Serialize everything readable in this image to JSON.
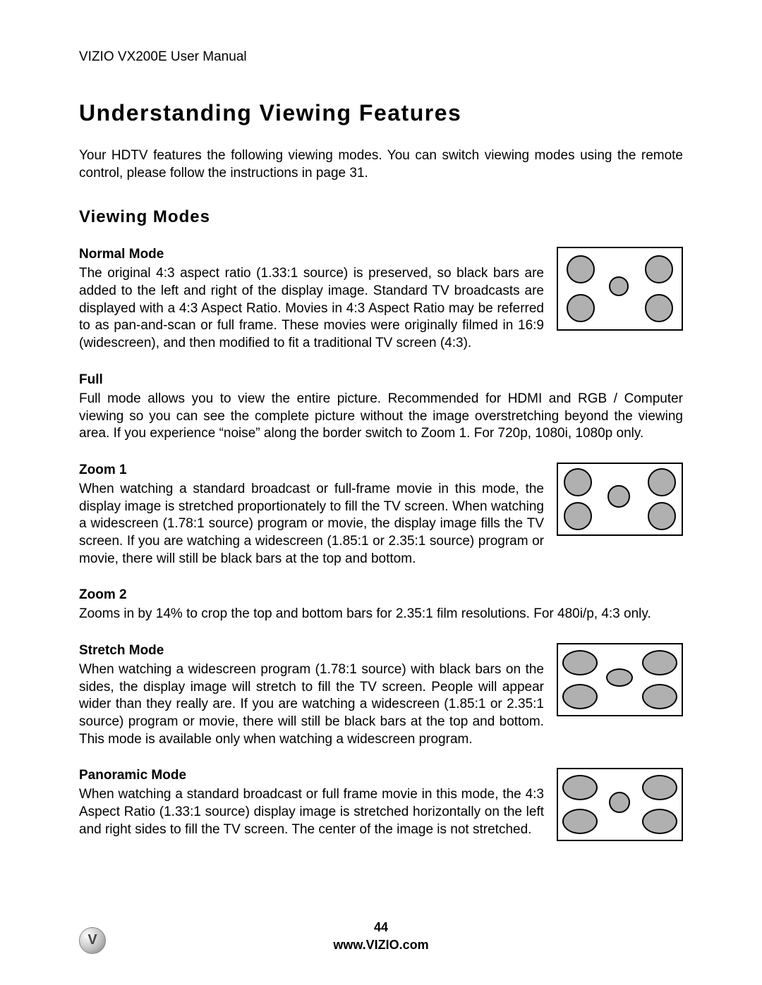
{
  "header": "VIZIO VX200E User Manual",
  "title": "Understanding Viewing Features",
  "intro": "Your HDTV features the following viewing modes. You can switch viewing modes using the remote control, please follow the instructions in page 31.",
  "subtitle": "Viewing Modes",
  "sections": {
    "normal": {
      "heading": "Normal Mode",
      "body": "The original 4:3 aspect ratio (1.33:1 source) is preserved, so black bars are added to the left and right of the display image.  Standard TV broadcasts are displayed with a 4:3 Aspect Ratio. Movies in 4:3 Aspect Ratio may be referred to as pan-and-scan or full frame. These movies were originally filmed in 16:9 (widescreen), and then modified to fit a traditional TV screen (4:3)."
    },
    "full": {
      "heading": "Full",
      "body": "Full mode allows you to view the entire picture. Recommended for HDMI and RGB / Computer viewing so you can see the complete picture without the image overstretching beyond the viewing area. If you experience “noise” along the border switch to Zoom 1. For 720p, 1080i, 1080p only."
    },
    "zoom1": {
      "heading": "Zoom 1",
      "body": "When watching a standard broadcast or full-frame movie in this mode, the display image is stretched proportionately to fill the TV screen. When watching a widescreen (1.78:1 source) program or movie, the display image fills the TV screen.  If you are watching a widescreen (1.85:1 or 2.35:1 source) program or movie, there will still be black bars at the top and bottom."
    },
    "zoom2": {
      "heading": "Zoom 2",
      "body": "Zooms in by 14% to crop the top and bottom bars for 2.35:1 film resolutions. For 480i/p, 4:3 only."
    },
    "stretch": {
      "heading": "Stretch Mode",
      "body": "When watching a widescreen program (1.78:1 source) with black bars on the sides, the display image will stretch to fill the TV screen. People will appear wider than they really are. If you are watching a widescreen (1.85:1 or 2.35:1 source) program or movie, there will still be black bars at the top and bottom. This mode is available only when watching a widescreen program."
    },
    "panoramic": {
      "heading": "Panoramic Mode",
      "body": "When watching a standard broadcast or full frame movie in this mode, the 4:3 Aspect Ratio (1.33:1 source) display image is stretched horizontally on the left and right sides to fill the TV screen. The center of the image is not stretched."
    }
  },
  "footer": {
    "page_number": "44",
    "url": "www.VIZIO.com"
  }
}
